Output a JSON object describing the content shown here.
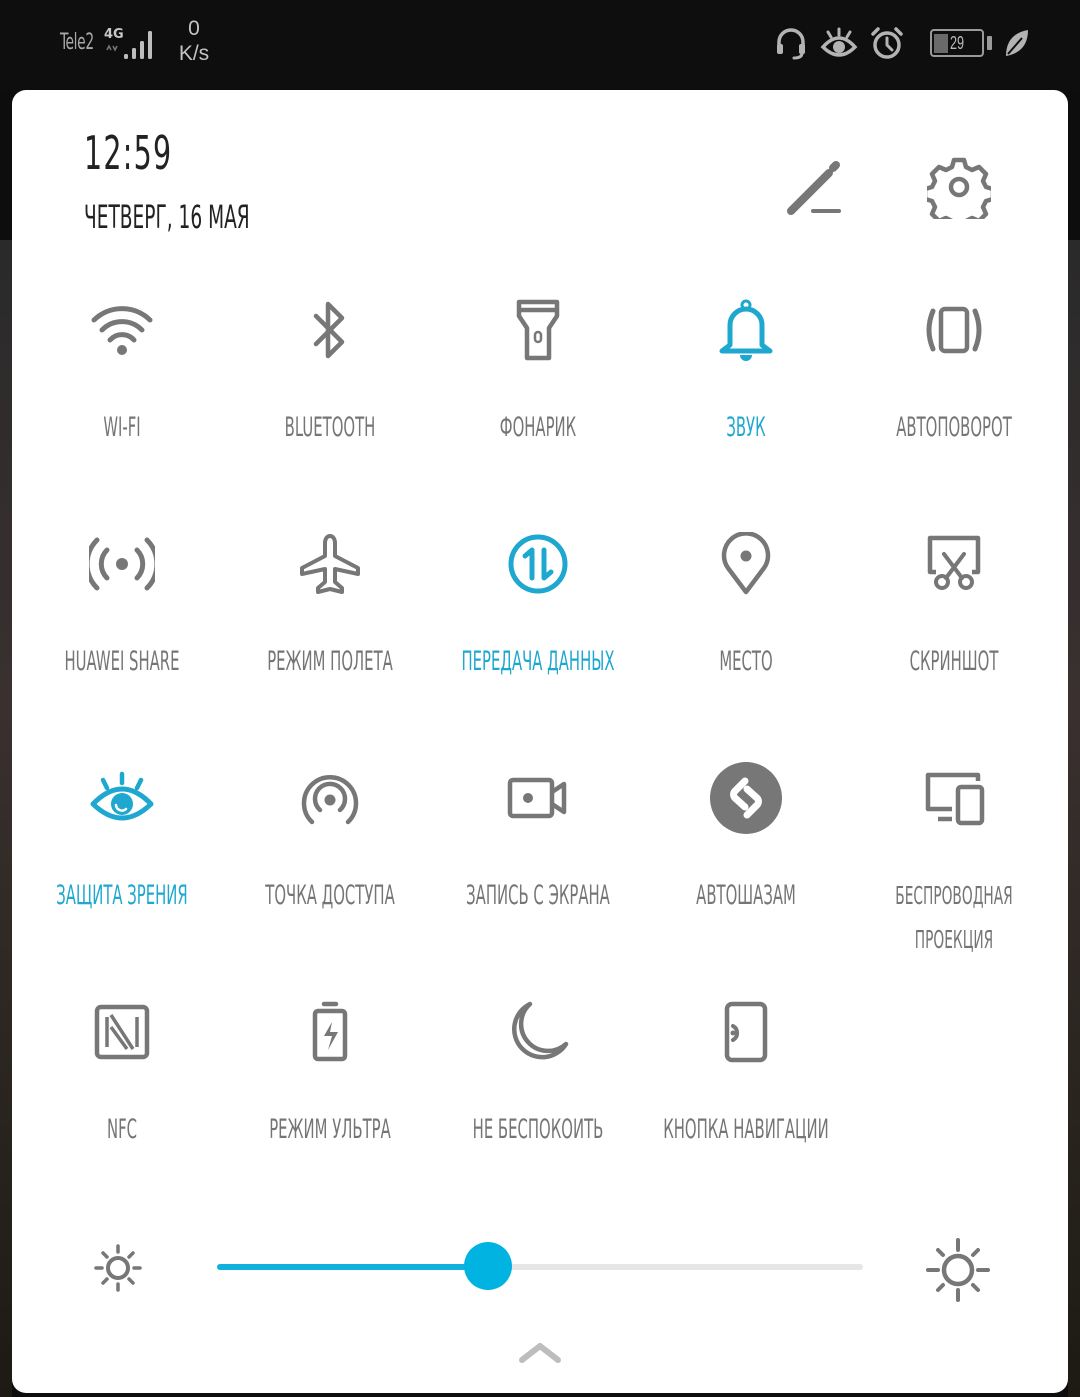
{
  "status_bar": {
    "carrier": "Tele2",
    "network_type": "4G",
    "signal_bars": 4,
    "speed_value": "0",
    "speed_unit": "K/s",
    "icons": [
      "headset-icon",
      "eye-comfort-icon",
      "alarm-icon",
      "battery-icon",
      "leaf-icon"
    ],
    "battery_percent": "29"
  },
  "header": {
    "time": "12:59",
    "date": "Четверг, 16 мая",
    "edit_icon": "pencil-icon",
    "settings_icon": "gear-icon"
  },
  "colors": {
    "accent": "#1ea7cf",
    "icon_inactive": "#757575",
    "panel_bg": "#ffffff",
    "statusbar_bg": "#0e0e0e"
  },
  "tiles": [
    {
      "id": "wifi",
      "label": "Wi-Fi",
      "icon": "wifi-icon",
      "active": false
    },
    {
      "id": "bluetooth",
      "label": "Bluetooth",
      "icon": "bluetooth-icon",
      "active": false
    },
    {
      "id": "flashlight",
      "label": "Фонарик",
      "icon": "flashlight-icon",
      "active": false
    },
    {
      "id": "sound",
      "label": "Звук",
      "icon": "bell-icon",
      "active": true
    },
    {
      "id": "autorotate",
      "label": "Автоповорот",
      "icon": "rotate-icon",
      "active": false
    },
    {
      "id": "huawei-share",
      "label": "Huawei Share",
      "icon": "share-broadcast-icon",
      "active": false
    },
    {
      "id": "airplane",
      "label": "Режим полета",
      "icon": "airplane-icon",
      "active": false
    },
    {
      "id": "mobile-data",
      "label": "Передача данных",
      "icon": "data-transfer-icon",
      "active": true
    },
    {
      "id": "location",
      "label": "Место",
      "icon": "location-pin-icon",
      "active": false
    },
    {
      "id": "screenshot",
      "label": "Скриншот",
      "icon": "screenshot-scissors-icon",
      "active": false
    },
    {
      "id": "eye-comfort",
      "label": "Защита зрения",
      "icon": "eye-icon",
      "active": true
    },
    {
      "id": "hotspot",
      "label": "Точка доступа",
      "icon": "hotspot-icon",
      "active": false
    },
    {
      "id": "screen-record",
      "label": "Запись с экрана",
      "icon": "video-camera-icon",
      "active": false
    },
    {
      "id": "auto-shazam",
      "label": "Автошазам",
      "icon": "shazam-icon",
      "active": false
    },
    {
      "id": "wireless-projection",
      "label": "Беспроводная проекция",
      "icon": "devices-icon",
      "active": false
    },
    {
      "id": "nfc",
      "label": "NFC",
      "icon": "nfc-icon",
      "active": false
    },
    {
      "id": "ultra-mode",
      "label": "Режим Ультра",
      "icon": "battery-bolt-icon",
      "active": false
    },
    {
      "id": "dnd",
      "label": "Не беспокоить",
      "icon": "moon-icon",
      "active": false
    },
    {
      "id": "nav-button",
      "label": "Кнопка навигации",
      "icon": "nav-dock-icon",
      "active": false
    }
  ],
  "brightness": {
    "level": 0.42,
    "min_icon": "sun-small-icon",
    "max_icon": "sun-large-icon"
  },
  "collapse_icon": "chevron-up-icon"
}
